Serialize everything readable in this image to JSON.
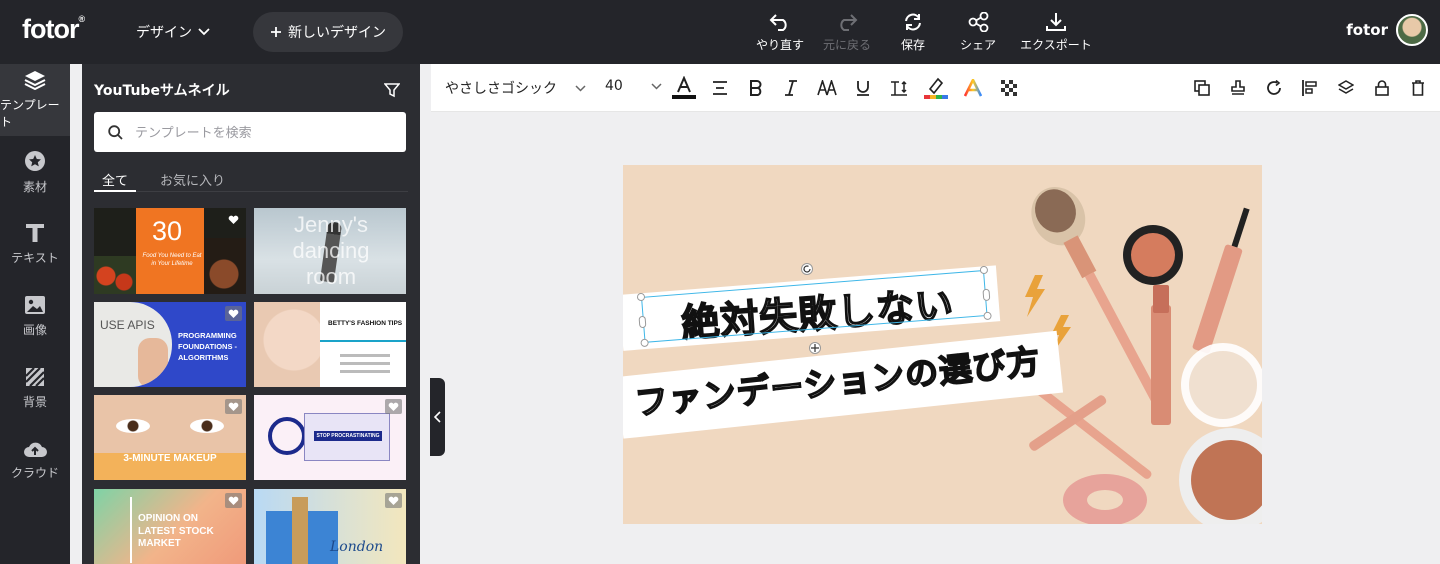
{
  "app": {
    "logo": "fotor",
    "logo_mark": "®"
  },
  "topbar": {
    "design_menu": "デザイン",
    "new_design": "新しいデザイン",
    "actions": [
      {
        "label": "やり直す",
        "icon": "undo-icon",
        "enabled": true
      },
      {
        "label": "元に戻る",
        "icon": "redo-icon",
        "enabled": false
      },
      {
        "label": "保存",
        "icon": "save-icon",
        "enabled": true
      },
      {
        "label": "シェア",
        "icon": "share-icon",
        "enabled": true
      },
      {
        "label": "エクスポート",
        "icon": "download-icon",
        "enabled": true
      }
    ],
    "user_name": "fotor"
  },
  "rail": {
    "items": [
      {
        "label": "テンプレート",
        "icon": "layers-icon",
        "active": true
      },
      {
        "label": "素材",
        "icon": "star-icon",
        "active": false
      },
      {
        "label": "テキスト",
        "icon": "text-icon",
        "active": false
      },
      {
        "label": "画像",
        "icon": "image-icon",
        "active": false
      },
      {
        "label": "背景",
        "icon": "background-icon",
        "active": false
      },
      {
        "label": "クラウド",
        "icon": "cloud-upload-icon",
        "active": false
      }
    ]
  },
  "panel": {
    "title": "YouTubeサムネイル",
    "search_placeholder": "テンプレートを検索",
    "tabs": [
      "全て",
      "お気に入り"
    ],
    "templates": [
      {
        "text": "30",
        "sub": "Food You Need to Eat in Your Lifetime"
      },
      {
        "text": "Jenny's dancing room"
      },
      {
        "text": "PROGRAMMING FOUNDATIONS -ALGORITHMS",
        "sub": "USE APIS"
      },
      {
        "text": "BETTY'S FASHION TIPS"
      },
      {
        "text": "3-MINUTE MAKEUP"
      },
      {
        "text": "STOP PROCRASTINATING"
      },
      {
        "text": "OPINION ON LATEST STOCK MARKET"
      },
      {
        "text": "London"
      }
    ]
  },
  "toolbar": {
    "font": "やさしさゴシック",
    "size": "40",
    "text_color": "#111111"
  },
  "canvas": {
    "line1": "絶対失敗しない",
    "line2": "ファンデーションの選び方",
    "background": "#f0d8c0"
  },
  "colors": {
    "topbar": "#24252a",
    "panel": "#2c2d32",
    "selection": "#3fb7e8"
  }
}
